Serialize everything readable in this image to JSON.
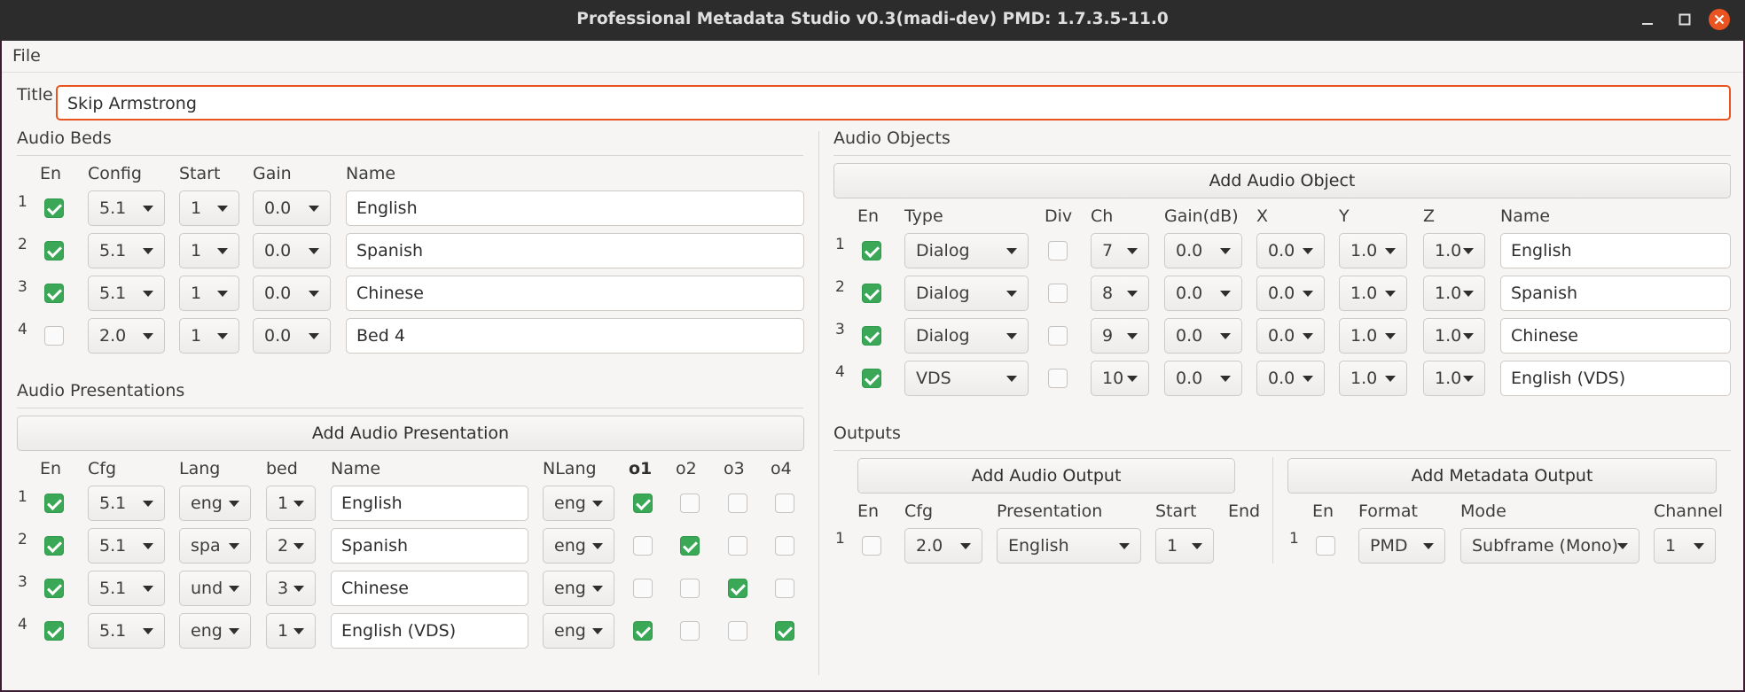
{
  "window": {
    "title": "Professional Metadata Studio v0.3(madi-dev) PMD: 1.7.3.5-11.0"
  },
  "menu": {
    "file": "File"
  },
  "title_field": {
    "label": "Title",
    "value": "Skip Armstrong"
  },
  "beds": {
    "section": "Audio Beds",
    "headers": {
      "en": "En",
      "config": "Config",
      "start": "Start",
      "gain": "Gain",
      "name": "Name"
    },
    "rows": [
      {
        "num": "1",
        "en": true,
        "config": "5.1",
        "start": "1",
        "gain": "0.0",
        "name": "English"
      },
      {
        "num": "2",
        "en": true,
        "config": "5.1",
        "start": "1",
        "gain": "0.0",
        "name": "Spanish"
      },
      {
        "num": "3",
        "en": true,
        "config": "5.1",
        "start": "1",
        "gain": "0.0",
        "name": "Chinese"
      },
      {
        "num": "4",
        "en": false,
        "config": "2.0",
        "start": "1",
        "gain": "0.0",
        "name": "Bed 4"
      }
    ]
  },
  "presentations": {
    "section": "Audio Presentations",
    "add_button": "Add Audio Presentation",
    "headers": {
      "en": "En",
      "cfg": "Cfg",
      "lang": "Lang",
      "bed": "bed",
      "name": "Name",
      "nlang": "NLang",
      "o1": "o1",
      "o2": "o2",
      "o3": "o3",
      "o4": "o4"
    },
    "rows": [
      {
        "num": "1",
        "en": true,
        "cfg": "5.1",
        "lang": "eng",
        "bed": "1",
        "name": "English",
        "nlang": "eng",
        "o": [
          true,
          false,
          false,
          false
        ]
      },
      {
        "num": "2",
        "en": true,
        "cfg": "5.1",
        "lang": "spa",
        "bed": "2",
        "name": "Spanish",
        "nlang": "eng",
        "o": [
          false,
          true,
          false,
          false
        ]
      },
      {
        "num": "3",
        "en": true,
        "cfg": "5.1",
        "lang": "und",
        "bed": "3",
        "name": "Chinese",
        "nlang": "eng",
        "o": [
          false,
          false,
          true,
          false
        ]
      },
      {
        "num": "4",
        "en": true,
        "cfg": "5.1",
        "lang": "eng",
        "bed": "1",
        "name": "English (VDS)",
        "nlang": "eng",
        "o": [
          true,
          false,
          false,
          true
        ]
      }
    ]
  },
  "objects": {
    "section": "Audio Objects",
    "add_button": "Add Audio Object",
    "headers": {
      "en": "En",
      "type": "Type",
      "div": "Div",
      "ch": "Ch",
      "gain": "Gain(dB)",
      "x": "X",
      "y": "Y",
      "z": "Z",
      "name": "Name"
    },
    "rows": [
      {
        "num": "1",
        "en": true,
        "type": "Dialog",
        "div": false,
        "ch": "7",
        "gain": "0.0",
        "x": "0.0",
        "y": "1.0",
        "z": "1.0",
        "name": "English"
      },
      {
        "num": "2",
        "en": true,
        "type": "Dialog",
        "div": false,
        "ch": "8",
        "gain": "0.0",
        "x": "0.0",
        "y": "1.0",
        "z": "1.0",
        "name": "Spanish"
      },
      {
        "num": "3",
        "en": true,
        "type": "Dialog",
        "div": false,
        "ch": "9",
        "gain": "0.0",
        "x": "0.0",
        "y": "1.0",
        "z": "1.0",
        "name": "Chinese"
      },
      {
        "num": "4",
        "en": true,
        "type": "VDS",
        "div": false,
        "ch": "10",
        "gain": "0.0",
        "x": "0.0",
        "y": "1.0",
        "z": "1.0",
        "name": "English (VDS)"
      }
    ]
  },
  "outputs": {
    "section": "Outputs",
    "audio": {
      "add_button": "Add Audio Output",
      "headers": {
        "en": "En",
        "cfg": "Cfg",
        "presentation": "Presentation",
        "start": "Start",
        "end": "End"
      },
      "rows": [
        {
          "num": "1",
          "en": false,
          "cfg": "2.0",
          "presentation": "English",
          "start": "1"
        }
      ]
    },
    "metadata": {
      "add_button": "Add Metadata Output",
      "headers": {
        "en": "En",
        "format": "Format",
        "mode": "Mode",
        "channel": "Channel"
      },
      "rows": [
        {
          "num": "1",
          "en": false,
          "format": "PMD",
          "mode": "Subframe (Mono)",
          "channel": "1"
        }
      ]
    }
  },
  "colors": {
    "accent": "#e95420",
    "checked": "#3aa857",
    "titlebar": "#2c2c2c",
    "close": "#e95420"
  }
}
